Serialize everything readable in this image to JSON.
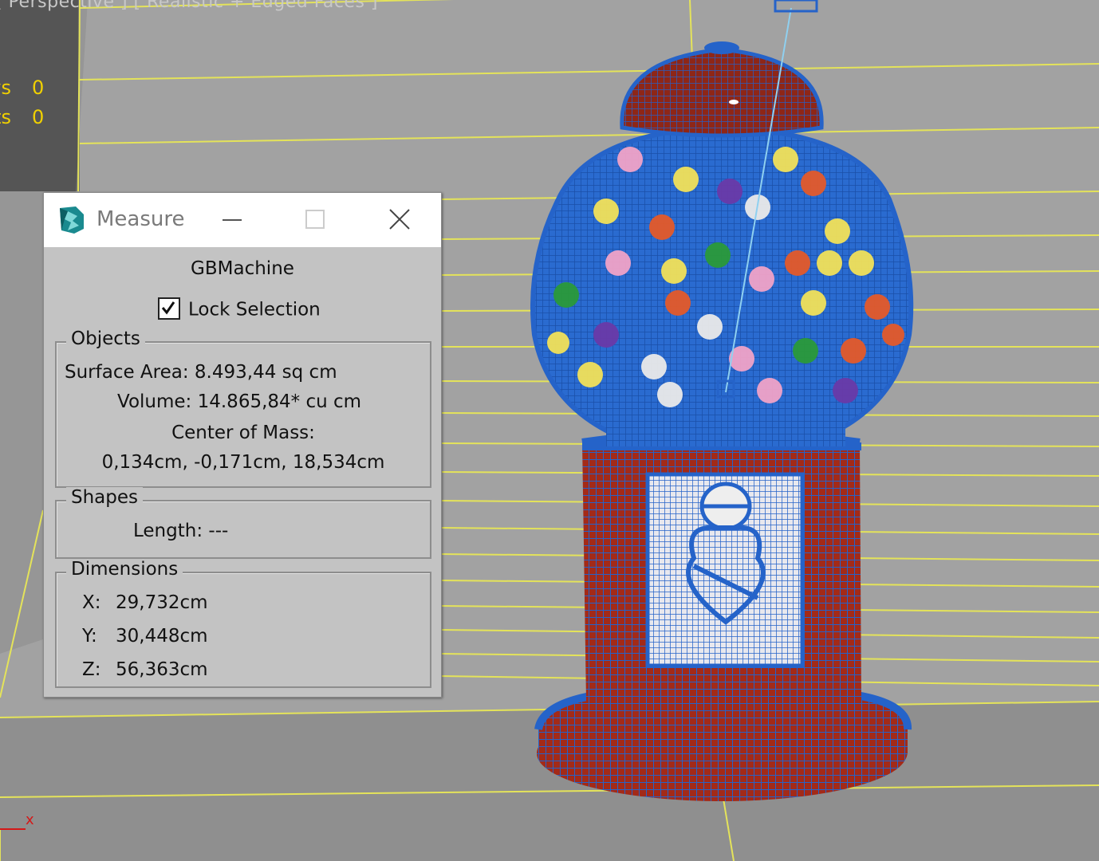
{
  "viewport": {
    "label": "[ Perspective ] [ Realistic + Edged Faces ]",
    "stats": [
      {
        "label": "Polys:",
        "value": "0"
      },
      {
        "label": "Verts:",
        "value": "0"
      }
    ],
    "axis_label": "x",
    "colors": {
      "background": "#9d9d9d",
      "grid": "#e4e35a",
      "model_wire": "#2563c9",
      "model_body": "#9b2c1a",
      "stats": "#f0d000"
    }
  },
  "dialog": {
    "title": "Measure",
    "icon": "3ds-max-logo-icon",
    "object_name": "GBMachine",
    "lock_selection": {
      "label": "Lock Selection",
      "checked": true
    },
    "objects": {
      "legend": "Objects",
      "surface_area_label": "Surface Area:",
      "surface_area_value": "8.493,44 sq cm",
      "volume_label": "Volume:",
      "volume_value": "14.865,84* cu cm",
      "center_label": "Center of Mass:",
      "center_value": "0,134cm, -0,171cm, 18,534cm"
    },
    "shapes": {
      "legend": "Shapes",
      "length_label": "Length:",
      "length_value": "---"
    },
    "dimensions": {
      "legend": "Dimensions",
      "x_label": "X:",
      "x_value": "29,732cm",
      "y_label": "Y:",
      "y_value": "30,448cm",
      "z_label": "Z:",
      "z_value": "56,363cm"
    }
  }
}
